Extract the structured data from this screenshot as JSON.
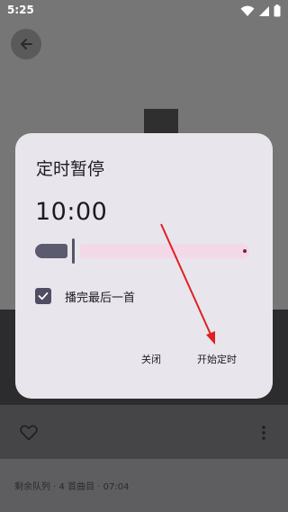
{
  "status_bar": {
    "time": "5:25"
  },
  "icons": {
    "back": "arrow-back-icon",
    "wifi": "wifi-icon",
    "signal": "signal-icon",
    "battery": "battery-icon",
    "heart": "heart-outline-icon",
    "more": "more-vertical-icon",
    "check": "check-icon"
  },
  "dialog": {
    "title": "定时暂停",
    "time_value": "10:00",
    "slider_value": 0.0,
    "checkbox_label": "播完最后一首",
    "checkbox_checked": true,
    "close_label": "关闭",
    "start_label": "开始定时"
  },
  "player": {
    "queue_text": "剩余队列 · 4 首曲目 · 07:04"
  },
  "colors": {
    "dialog_bg": "#e8e6ec",
    "slider_active": "#5c5a6e",
    "slider_track": "#f3d8e8",
    "annotation_arrow": "#e02020"
  }
}
